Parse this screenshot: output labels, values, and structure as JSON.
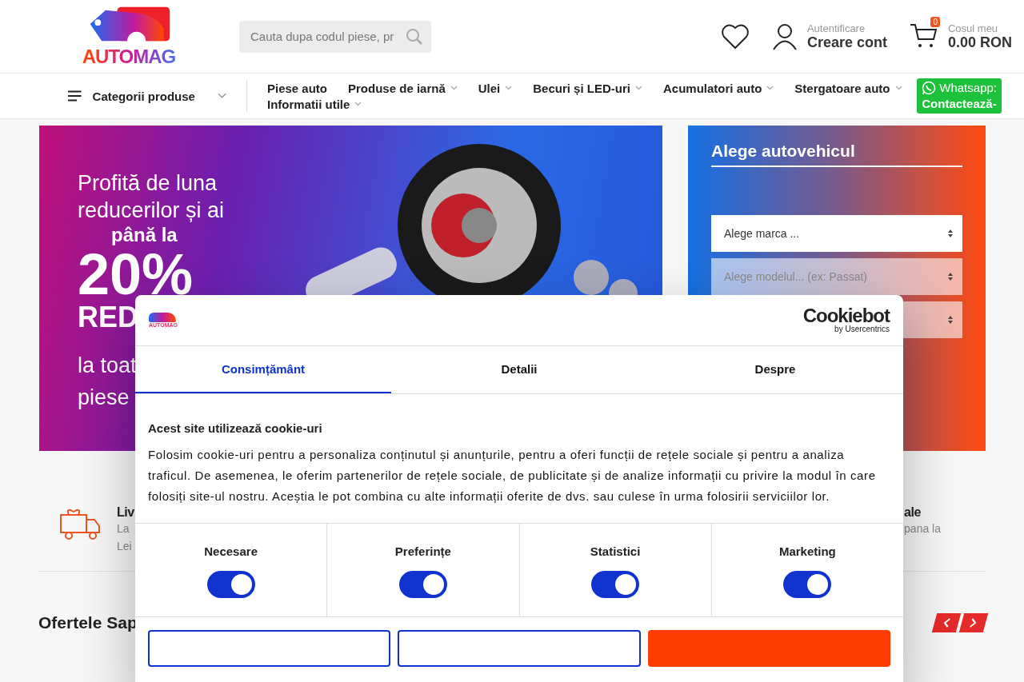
{
  "header": {
    "logo": "AUTOMAG",
    "search": {
      "placeholder": "Cauta dupa codul piese, pr"
    },
    "account": {
      "caption": "Autentificare",
      "label": "Creare cont"
    },
    "cart": {
      "count": "0",
      "caption": "Cosul meu",
      "total": "0.00 RON"
    }
  },
  "nav": {
    "categories": "Categorii produse",
    "items": [
      {
        "label": "Piese auto",
        "dropdown": false
      },
      {
        "label": "Produse de iarnă",
        "dropdown": true
      },
      {
        "label": "Ulei",
        "dropdown": true
      },
      {
        "label": "Becuri și LED-uri",
        "dropdown": true
      },
      {
        "label": "Acumulatori auto",
        "dropdown": true
      },
      {
        "label": "Stergatoare auto",
        "dropdown": true
      },
      {
        "label": "Informatii utile",
        "dropdown": true
      }
    ],
    "whatsapp": {
      "line1": "Whatsapp:",
      "line2": "Contactează-"
    }
  },
  "banner": {
    "lines": [
      "Profită de luna",
      "reducerilor și ai"
    ],
    "bold": "până la",
    "percent": "20%",
    "tag": "RED",
    "bottom": [
      "la toat",
      "piese"
    ]
  },
  "vehicle": {
    "title": "Alege autovehicul",
    "selects": [
      {
        "value": "Alege marca ...",
        "disabled": false
      },
      {
        "value": "Alege modelul... (ex: Passat)",
        "disabled": true
      }
    ]
  },
  "features": [
    {
      "title": "Liv",
      "lines": [
        "La",
        "Lei"
      ]
    },
    {
      "title": "ale",
      "lines": [
        "pana la"
      ]
    }
  ],
  "section": {
    "title": "Ofertele Sap"
  },
  "cookie": {
    "logo": "AUTOMAG",
    "brand": "Cookiebot",
    "brand_sub": "by Usercentrics",
    "tabs": [
      {
        "label": "Consimțământ",
        "selected": true
      },
      {
        "label": "Detalii",
        "selected": false
      },
      {
        "label": "Despre",
        "selected": false
      }
    ],
    "heading": "Acest site utilizează cookie-uri",
    "text": "Folosim cookie-uri pentru a personaliza conținutul și anunțurile, pentru a oferi funcții de rețele sociale și pentru a analiza traficul. De asemenea, le oferim partenerilor de rețele sociale, de publicitate și de analize informații cu privire la modul în care folosiți site-ul nostru. Aceștia le pot combina cu alte informații oferite de dvs. sau culese în urma folosirii serviciilor lor.",
    "toggles": [
      {
        "label": "Necesare",
        "on": true
      },
      {
        "label": "Preferințe",
        "on": true
      },
      {
        "label": "Statistici",
        "on": true
      },
      {
        "label": "Marketing",
        "on": true
      }
    ],
    "buttons": [
      {
        "kind": "outline"
      },
      {
        "kind": "outline"
      },
      {
        "kind": "primary"
      }
    ]
  }
}
